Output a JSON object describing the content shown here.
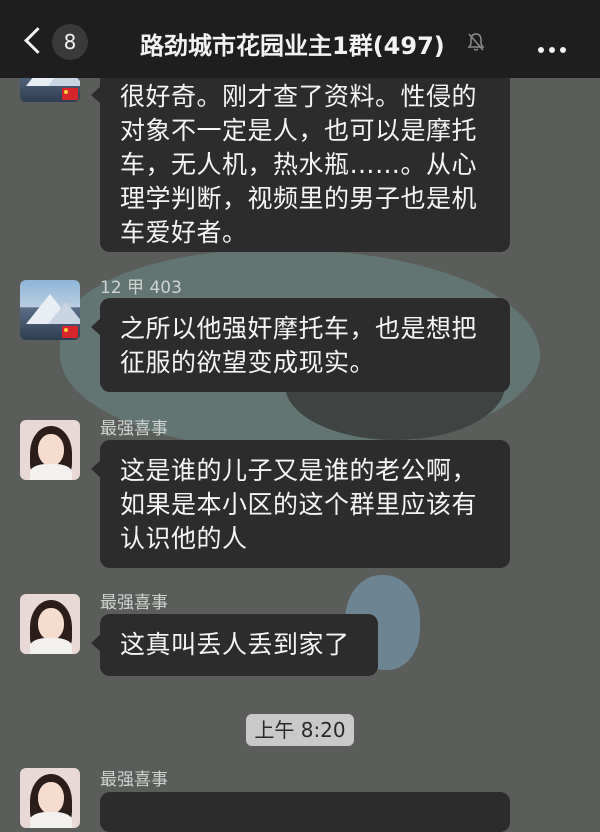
{
  "header": {
    "back_count": "8",
    "title": "路劲城市花园业主1群(497)",
    "mute_icon": "mute-bell-icon",
    "more_icon": "more-dots-icon"
  },
  "messages": [
    {
      "sender": "",
      "avatar": "mountain-avatar",
      "lines": [
        "很好奇。刚才查了资料。性侵的",
        "对象不一定是人，也可以是摩托",
        "车，无人机，热水瓶……。从心",
        "理学判断，视频里的男子也是机",
        "车爱好者。"
      ]
    },
    {
      "sender": "12 甲 403",
      "avatar": "mountain-avatar",
      "lines": [
        "之所以他强奸摩托车，也是想把",
        "征服的欲望变成现实。"
      ]
    },
    {
      "sender": "最强喜事",
      "avatar": "girl-avatar",
      "lines": [
        "这是谁的儿子又是谁的老公啊，",
        "如果是本小区的这个群里应该有",
        "认识他的人"
      ]
    },
    {
      "sender": "最强喜事",
      "avatar": "girl-avatar",
      "lines": [
        "这真叫丢人丢到家了"
      ]
    },
    {
      "sender": "最强喜事",
      "avatar": "girl-avatar",
      "lines": []
    }
  ],
  "timestamp": "上午 8:20",
  "colors": {
    "header_bg": "#1e1e1e",
    "bubble_bg": "#2c2c2c",
    "chat_bg": "#5a5d5a"
  }
}
